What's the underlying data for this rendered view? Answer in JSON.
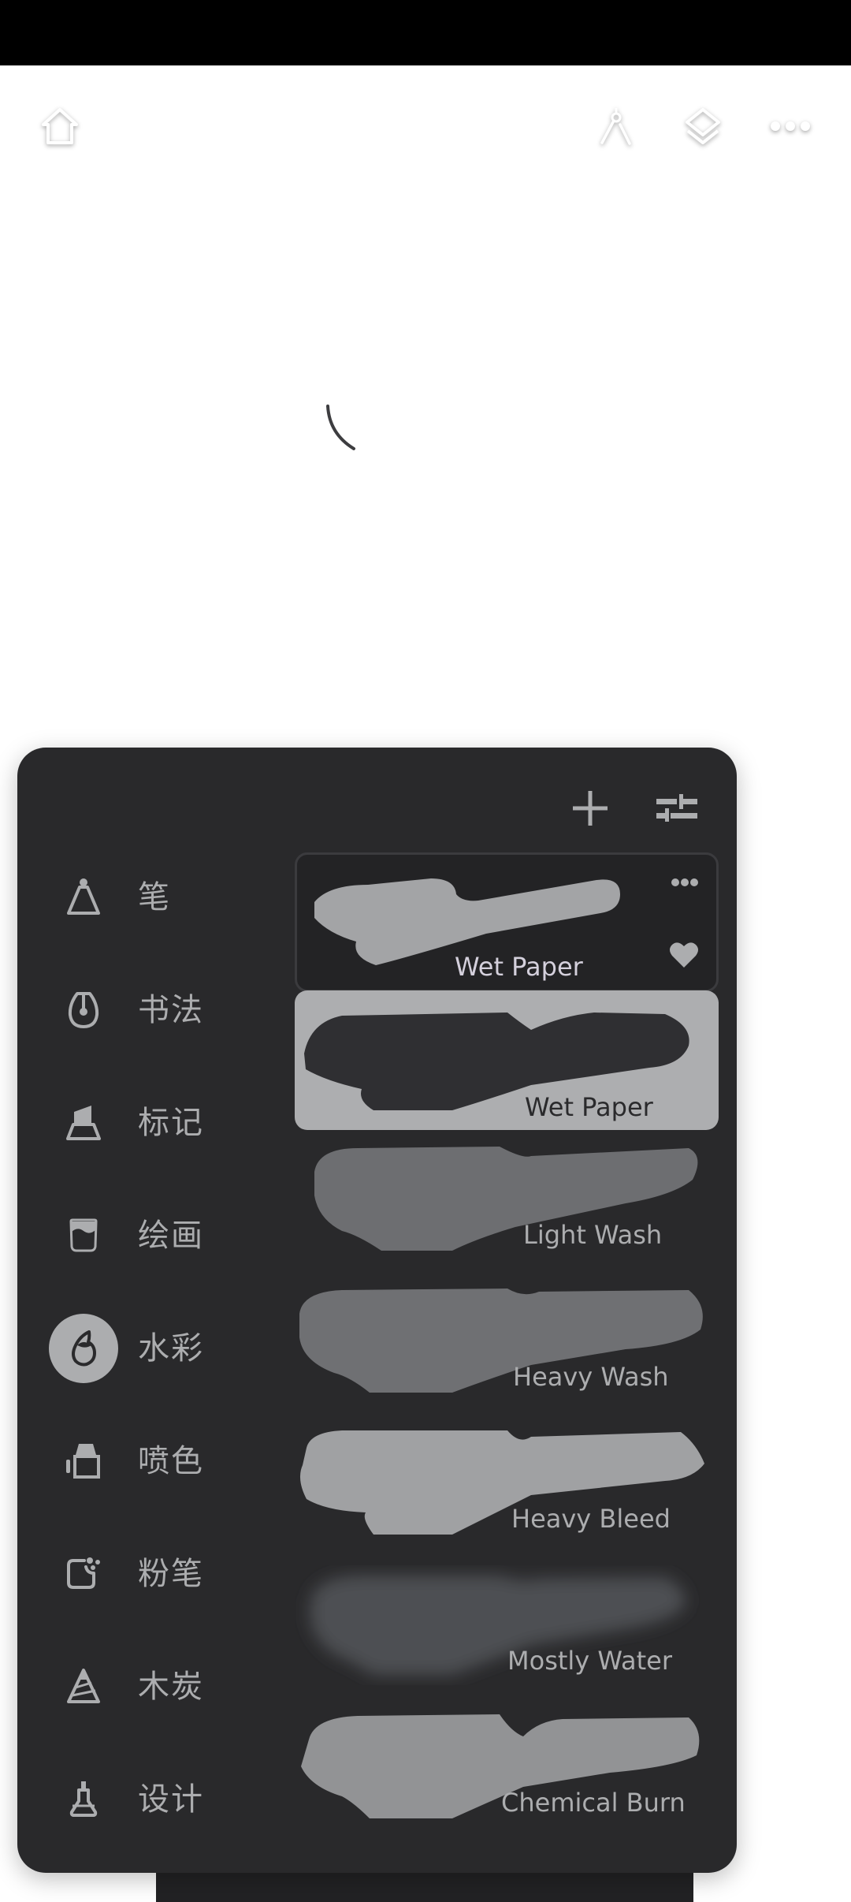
{
  "toolbar": {
    "left": [
      {
        "icon": "home-icon"
      }
    ],
    "right": [
      {
        "icon": "compass-icon"
      },
      {
        "icon": "layers-icon"
      },
      {
        "icon": "more-horizontal-icon"
      }
    ]
  },
  "panel": {
    "header_actions": [
      {
        "icon": "plus-icon"
      },
      {
        "icon": "sliders-icon"
      }
    ],
    "categories": [
      {
        "label": "笔",
        "icon": "pen-icon",
        "selected": false
      },
      {
        "label": "书法",
        "icon": "calligraphy-nib-icon",
        "selected": false
      },
      {
        "label": "标记",
        "icon": "marker-icon",
        "selected": false
      },
      {
        "label": "绘画",
        "icon": "paint-cup-icon",
        "selected": false
      },
      {
        "label": "水彩",
        "icon": "water-drop-icon",
        "selected": true
      },
      {
        "label": "喷色",
        "icon": "spray-icon",
        "selected": false
      },
      {
        "label": "粉笔",
        "icon": "chalk-icon",
        "selected": false
      },
      {
        "label": "木炭",
        "icon": "charcoal-icon",
        "selected": false
      },
      {
        "label": "设计",
        "icon": "design-pen-icon",
        "selected": false
      }
    ],
    "brushes": [
      {
        "name": "Wet Paper",
        "state": "custom",
        "favorite": true
      },
      {
        "name": "Wet Paper",
        "state": "selected"
      },
      {
        "name": "Light Wash",
        "state": "normal"
      },
      {
        "name": "Heavy Wash",
        "state": "normal"
      },
      {
        "name": "Heavy Bleed",
        "state": "normal"
      },
      {
        "name": "Mostly Water",
        "state": "normal"
      },
      {
        "name": "Chemical Burn",
        "state": "normal"
      }
    ]
  },
  "colors": {
    "panel_bg": "#29292b",
    "icon_text": "#acadaf",
    "selected_bg": "#adaeb0",
    "canvas_bg": "#ffffff"
  }
}
